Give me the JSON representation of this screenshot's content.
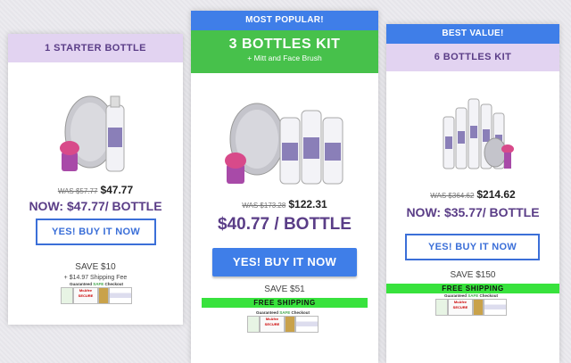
{
  "cards": [
    {
      "title": "1 STARTER BOTTLE",
      "was": "WAS $57.77",
      "price": "$47.77",
      "per_bottle": "NOW: $47.77/ BOTTLE",
      "button": "YES! BUY IT NOW",
      "save": "SAVE $10",
      "shipping": "+ $14.97 Shipping Fee",
      "colors": {
        "header_bg": "#e2d3f1",
        "header_text": "#5a3d87"
      }
    },
    {
      "banner": "MOST POPULAR!",
      "title": "3 BOTTLES KIT",
      "subtitle": "+ Mitt and Face Brush",
      "was": "WAS $173.28",
      "price": "$122.31",
      "per_bottle": "$40.77 / BOTTLE",
      "button": "YES! BUY IT NOW",
      "save": "SAVE $51",
      "free_shipping": "FREE SHIPPING",
      "colors": {
        "banner_bg": "#3f7ee8",
        "header_bg": "#47c14b",
        "button_bg": "#3f7ee8"
      }
    },
    {
      "banner": "BEST VALUE!",
      "title": "6 BOTTLES KIT",
      "was": "WAS $364.62",
      "price": "$214.62",
      "per_bottle": "NOW: $35.77/ BOTTLE",
      "button": "YES! BUY IT NOW",
      "save": "SAVE $150",
      "free_shipping": "FREE SHIPPING",
      "colors": {
        "free_shipping_bg": "#38e23d"
      }
    }
  ],
  "badge": {
    "pre": "Guaranteed ",
    "safe": "SAFE",
    "post": " Checkout",
    "mcafee_line1": "McAfee",
    "mcafee_line2": "SECURE"
  }
}
